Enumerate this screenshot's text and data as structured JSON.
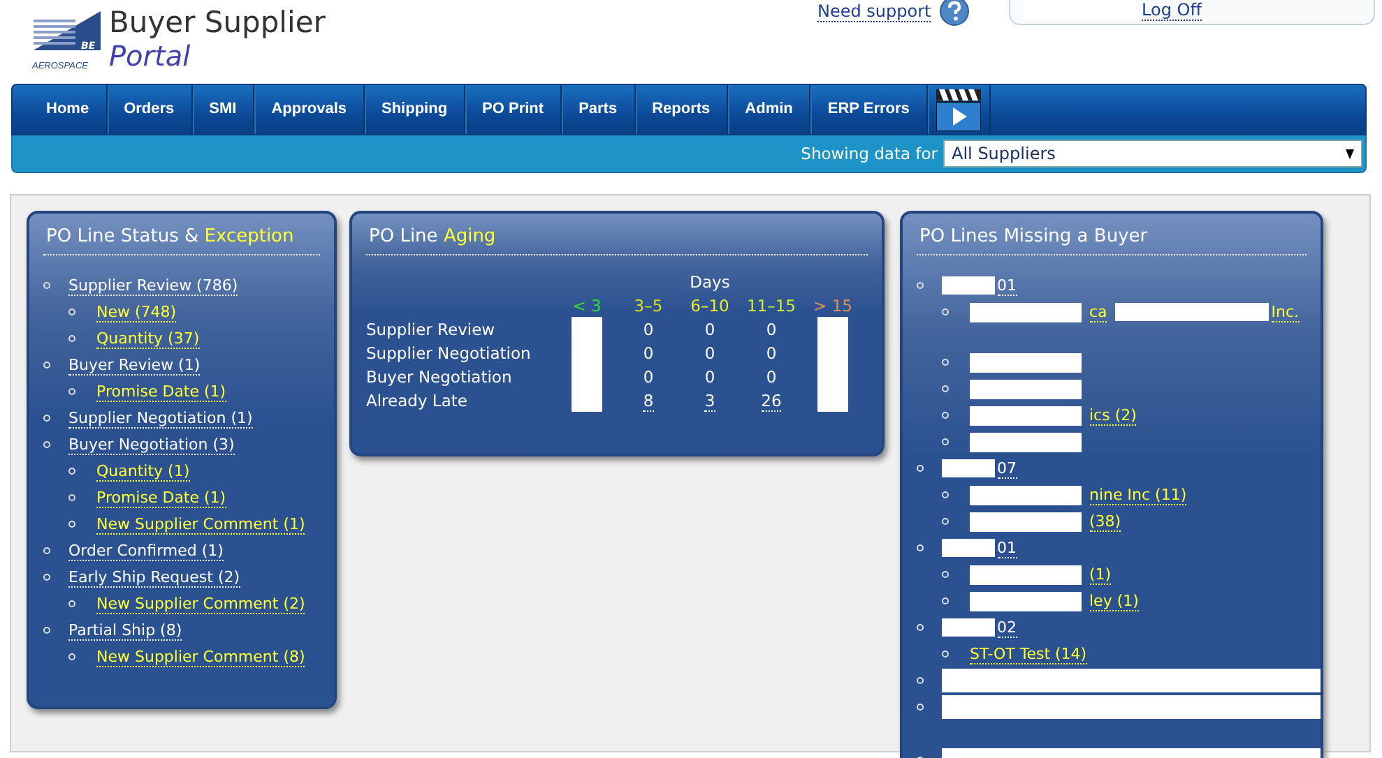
{
  "logo": {
    "mark": "BE",
    "tagline": "AEROSPACE"
  },
  "title": {
    "line1": "Buyer Supplier",
    "line2": "Portal"
  },
  "support_link": "Need support",
  "account": {
    "logoff": "Log Off"
  },
  "nav": [
    {
      "label": "Home",
      "kind": "text"
    },
    {
      "label": "Orders",
      "kind": "text"
    },
    {
      "label": "SMI",
      "kind": "text"
    },
    {
      "label": "Approvals",
      "kind": "text"
    },
    {
      "label": "Shipping",
      "kind": "text"
    },
    {
      "label": "PO Print",
      "kind": "text"
    },
    {
      "label": "Parts",
      "kind": "text"
    },
    {
      "label": "Reports",
      "kind": "text"
    },
    {
      "label": "Admin",
      "kind": "text"
    },
    {
      "label": "ERP Errors",
      "kind": "text"
    },
    {
      "kind": "video"
    }
  ],
  "filter": {
    "label": "Showing data for",
    "value": "All Suppliers"
  },
  "status_panel": {
    "title": "PO Line Status & ",
    "title_accent": "Exception",
    "items": [
      {
        "text": "Supplier Review (786)",
        "children": [
          {
            "text": "New (748)"
          },
          {
            "text": "Quantity (37)"
          }
        ]
      },
      {
        "text": "Buyer Review (1)",
        "children": [
          {
            "text": "Promise Date (1)"
          }
        ]
      },
      {
        "text": "Supplier Negotiation (1)"
      },
      {
        "text": "Buyer Negotiation (3)",
        "children": [
          {
            "text": "Quantity (1)"
          },
          {
            "text": "Promise Date (1)"
          },
          {
            "text": "New Supplier Comment (1)"
          }
        ]
      },
      {
        "text": "Order Confirmed (1)"
      },
      {
        "text": "Early Ship Request (2)",
        "children": [
          {
            "text": "New Supplier Comment (2)"
          }
        ]
      },
      {
        "text": "Partial Ship (8)",
        "children": [
          {
            "text": "New Supplier Comment (8)"
          }
        ]
      }
    ]
  },
  "aging_panel": {
    "title": "PO Line ",
    "title_accent": "Aging",
    "group_header": "Days",
    "columns": [
      {
        "label": "< 3",
        "color": "#33dd33"
      },
      {
        "label": "3–5",
        "color": "#dddd22"
      },
      {
        "label": "6–10",
        "color": "#eeee22"
      },
      {
        "label": "11–15",
        "color": "#ccee33"
      },
      {
        "label": "> 15",
        "color": "#e09050"
      }
    ],
    "rows": [
      {
        "label": "Supplier Review",
        "cells": [
          null,
          "0",
          "0",
          "0",
          null
        ]
      },
      {
        "label": "Supplier Negotiation",
        "cells": [
          null,
          "0",
          "0",
          "0",
          null
        ]
      },
      {
        "label": "Buyer Negotiation",
        "cells": [
          null,
          "0",
          "0",
          "0",
          null
        ]
      },
      {
        "label": "Already Late",
        "cells": [
          null,
          "8",
          "3",
          "26",
          null
        ],
        "linked": true
      }
    ]
  },
  "buyer_panel": {
    "title": "PO Lines Missing a Buyer",
    "items": [
      {
        "text": "01",
        "redacted": true,
        "children": [
          {
            "text": "ca",
            "tail": "Inc.",
            "redacted": true,
            "wrapped": true
          },
          {
            "redacted": true
          },
          {
            "redacted": true
          },
          {
            "text": "ics (2)",
            "redacted": true
          },
          {
            "redacted": true
          }
        ]
      },
      {
        "text": "07",
        "redacted": true,
        "children": [
          {
            "text": "nine Inc (11)",
            "redacted": true
          },
          {
            "text": "(38)",
            "redacted": true
          }
        ]
      },
      {
        "text": "01",
        "redacted": true,
        "children": [
          {
            "text": "(1)",
            "redacted": true
          },
          {
            "text": "ley (1)",
            "redacted": true
          }
        ]
      },
      {
        "text": "02",
        "redacted": true,
        "children": [
          {
            "text": "ST-OT Test (14)",
            "redacted": false
          }
        ]
      },
      {
        "redacted": true
      },
      {
        "redacted": true
      },
      {
        "redacted": true
      }
    ]
  }
}
